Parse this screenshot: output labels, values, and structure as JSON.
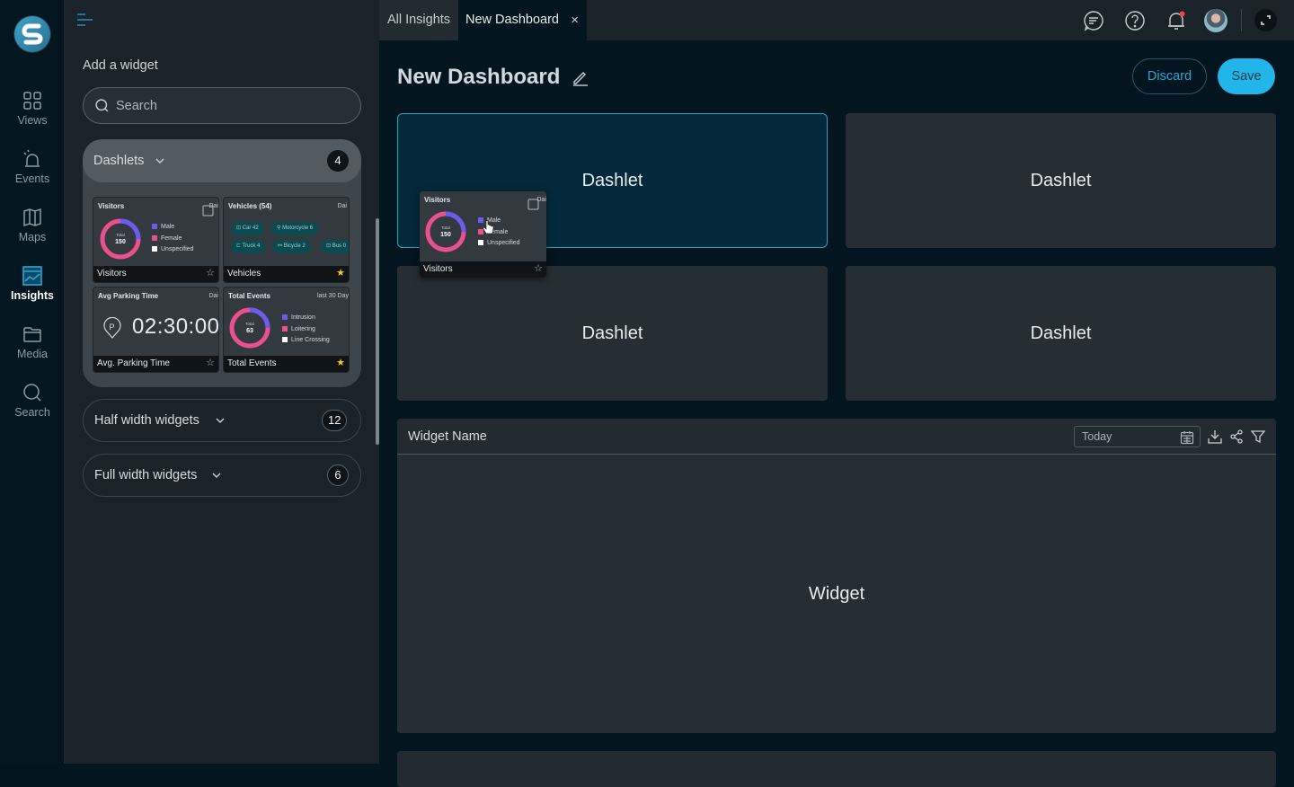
{
  "rail": {
    "items": [
      {
        "label": "Views",
        "icon": "grid-icon"
      },
      {
        "label": "Events",
        "icon": "siren-icon"
      },
      {
        "label": "Maps",
        "icon": "map-icon"
      },
      {
        "label": "Insights",
        "icon": "insights-icon",
        "active": true
      },
      {
        "label": "Media",
        "icon": "folder-icon"
      },
      {
        "label": "Search",
        "icon": "search-icon"
      }
    ]
  },
  "panel": {
    "title": "Add a widget",
    "search_placeholder": "Search",
    "groups": [
      {
        "label": "Dashlets",
        "count": "4",
        "expanded": true
      },
      {
        "label": "Half width widgets",
        "count": "12",
        "expanded": false
      },
      {
        "label": "Full width widgets",
        "count": "6",
        "expanded": false
      }
    ],
    "dashlets": [
      {
        "title": "Visitors",
        "range": "Dai",
        "footer": "Visitors",
        "favorite": false,
        "donut": {
          "center_label": "Total",
          "total": "150"
        },
        "legend": [
          {
            "label": "Male",
            "color": "#6b5cf0"
          },
          {
            "label": "Female",
            "color": "#ea4f8f"
          },
          {
            "label": "Unspecified",
            "color": "#ffffff"
          }
        ]
      },
      {
        "title": "Vehicles (54)",
        "range": "Dai",
        "footer": "Vehicles",
        "favorite": true,
        "chips": [
          "Car 42",
          "Motorcycle 6",
          "Truck 4",
          "Bicycle 2",
          "Bus 0"
        ]
      },
      {
        "title": "Avg Parking Time",
        "range": "Dai",
        "footer": "Avg. Parking Time",
        "favorite": false,
        "value": "02:30:00"
      },
      {
        "title": "Total Events",
        "range": "last 30 Day",
        "footer": "Total Events",
        "favorite": true,
        "donut": {
          "center_label": "Total",
          "total": "63"
        },
        "legend": [
          {
            "label": "Intrusion",
            "color": "#6b5cf0"
          },
          {
            "label": "Loitering",
            "color": "#ea4f8f"
          },
          {
            "label": "Line Crossing",
            "color": "#ffffff"
          }
        ]
      }
    ]
  },
  "tabs": {
    "all": "All Insights",
    "current": "New Dashboard",
    "close": "×"
  },
  "header_icons": [
    "chat-icon",
    "help-icon",
    "bell-icon",
    "avatar",
    "expand-icon"
  ],
  "main": {
    "title": "New Dashboard",
    "discard": "Discard",
    "save": "Save",
    "slots": [
      "Dashlet",
      "Dashlet",
      "Dashlet",
      "Dashlet"
    ],
    "widget": {
      "name": "Widget Name",
      "date": "Today",
      "body": "Widget"
    }
  },
  "drag": {
    "title": "Visitors",
    "range": "Dai",
    "footer": "Visitors",
    "total_label": "Total",
    "total": "150",
    "legend": [
      "Male",
      "Female",
      "Unspecified"
    ]
  },
  "colors": {
    "accent": "#22b5ea",
    "male": "#6b5cf0",
    "female": "#ea4f8f",
    "star": "#f5c518"
  }
}
